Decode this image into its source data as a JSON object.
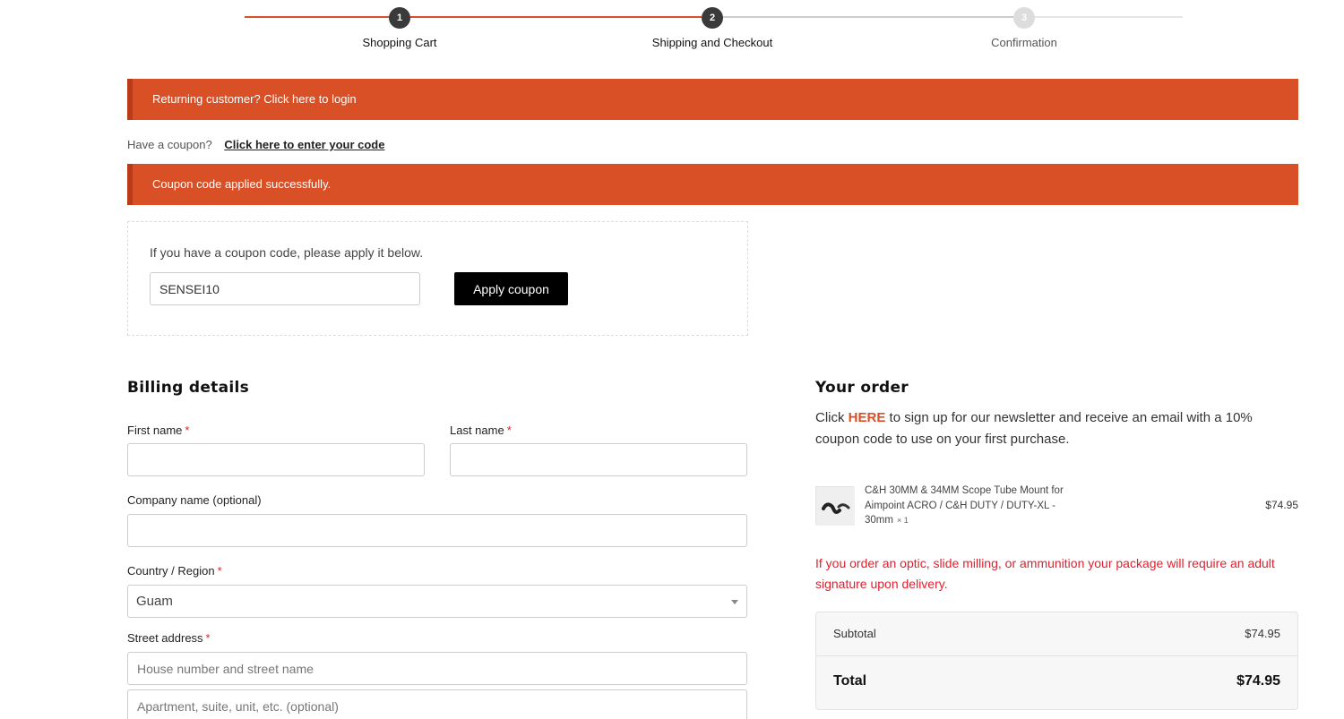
{
  "colors": {
    "accent": "#d95027",
    "dark": "#333333",
    "inactive": "#cccccc",
    "warning": "#e0202f"
  },
  "steps": [
    {
      "number": "1",
      "label": "Shopping Cart",
      "state": "complete"
    },
    {
      "number": "2",
      "label": "Shipping and Checkout",
      "state": "current"
    },
    {
      "number": "3",
      "label": "Confirmation",
      "state": "pending"
    }
  ],
  "notices": {
    "login": "Returning customer? Click here to login",
    "coupon_applied": "Coupon code applied successfully."
  },
  "coupon_toggle": {
    "prompt": "Have a coupon?",
    "link": "Click here to enter your code"
  },
  "coupon_form": {
    "hint": "If you have a coupon code, please apply it below.",
    "code_value": "SENSEI10",
    "button": "Apply coupon"
  },
  "billing": {
    "title": "Billing details",
    "first_name": {
      "label": "First name",
      "required": "*",
      "value": ""
    },
    "last_name": {
      "label": "Last name",
      "required": "*",
      "value": ""
    },
    "company": {
      "label": "Company name (optional)",
      "value": ""
    },
    "country": {
      "label": "Country / Region",
      "required": "*",
      "value": "Guam"
    },
    "street": {
      "label": "Street address",
      "required": "*",
      "placeholder1": "House number and street name",
      "placeholder2": "Apartment, suite, unit, etc. (optional)"
    }
  },
  "order": {
    "title": "Your order",
    "newsletter_pre": "Click ",
    "newsletter_link": "HERE",
    "newsletter_post": " to sign up for our newsletter and receive an email with a 10% coupon code to use on your first purchase.",
    "product": {
      "name": "C&H 30MM & 34MM Scope Tube Mount for Aimpoint ACRO / C&H DUTY / DUTY-XL - 30mm",
      "qty": "× 1",
      "price": "$74.95",
      "thumbnail_icon": "scope-mount-icon"
    },
    "warning": "If you order an optic, slide milling, or ammunition your package will require an adult signature upon delivery.",
    "subtotal_label": "Subtotal",
    "subtotal_value": "$74.95",
    "total_label": "Total",
    "total_value": "$74.95"
  }
}
